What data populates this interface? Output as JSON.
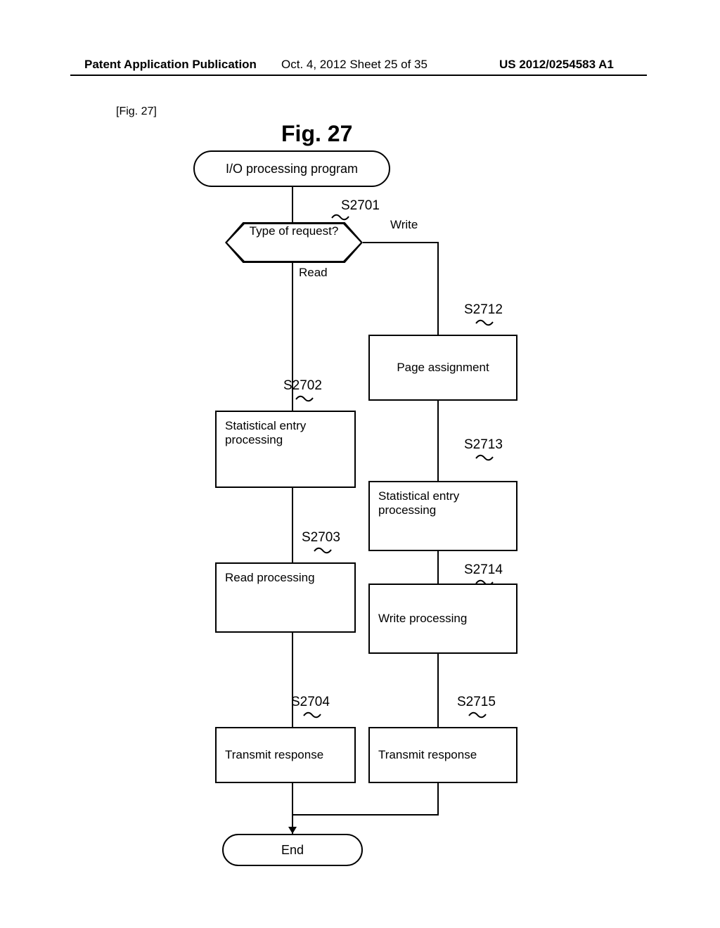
{
  "header": {
    "left": "Patent Application Publication",
    "mid": "Oct. 4, 2012  Sheet 25 of 35",
    "right": "US 2012/0254583 A1"
  },
  "fig_ref": "[Fig. 27]",
  "fig_title": "Fig. 27",
  "terminators": {
    "start": "I/O processing program",
    "end": "End"
  },
  "decision": {
    "label": "Type of request?"
  },
  "branches": {
    "read": "Read",
    "write": "Write"
  },
  "steps": {
    "s2701": "S2701",
    "s2702": "S2702",
    "s2703": "S2703",
    "s2704": "S2704",
    "s2712": "S2712",
    "s2713": "S2713",
    "s2714": "S2714",
    "s2715": "S2715"
  },
  "processes": {
    "stat_read": "Statistical entry processing",
    "read_proc": "Read processing",
    "resp_read": "Transmit response",
    "page_assign": "Page assignment",
    "stat_write": "Statistical entry processing",
    "write_proc": "Write processing",
    "resp_write": "Transmit response"
  },
  "chart_data": {
    "type": "flowchart",
    "title": "Fig. 27 — I/O processing program",
    "nodes": [
      {
        "id": "start",
        "kind": "terminator",
        "label": "I/O processing program"
      },
      {
        "id": "S2701",
        "kind": "decision",
        "label": "Type of request?"
      },
      {
        "id": "S2702",
        "kind": "process",
        "label": "Statistical entry processing"
      },
      {
        "id": "S2703",
        "kind": "process",
        "label": "Read processing"
      },
      {
        "id": "S2704",
        "kind": "process",
        "label": "Transmit response"
      },
      {
        "id": "S2712",
        "kind": "process",
        "label": "Page assignment"
      },
      {
        "id": "S2713",
        "kind": "process",
        "label": "Statistical entry processing"
      },
      {
        "id": "S2714",
        "kind": "process",
        "label": "Write processing"
      },
      {
        "id": "S2715",
        "kind": "process",
        "label": "Transmit response"
      },
      {
        "id": "end",
        "kind": "terminator",
        "label": "End"
      }
    ],
    "edges": [
      {
        "from": "start",
        "to": "S2701"
      },
      {
        "from": "S2701",
        "to": "S2702",
        "label": "Read"
      },
      {
        "from": "S2701",
        "to": "S2712",
        "label": "Write"
      },
      {
        "from": "S2702",
        "to": "S2703"
      },
      {
        "from": "S2703",
        "to": "S2704"
      },
      {
        "from": "S2704",
        "to": "end"
      },
      {
        "from": "S2712",
        "to": "S2713"
      },
      {
        "from": "S2713",
        "to": "S2714"
      },
      {
        "from": "S2714",
        "to": "S2715"
      },
      {
        "from": "S2715",
        "to": "end"
      }
    ]
  }
}
